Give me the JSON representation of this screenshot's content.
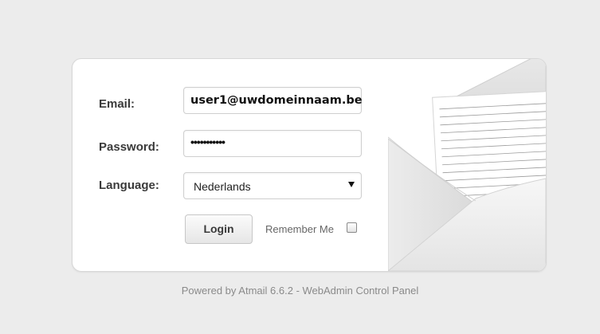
{
  "login": {
    "email_label": "Email:",
    "email_value": "user1@uwdomeinnaam.be",
    "password_label": "Password:",
    "password_value": "•••••••••••",
    "language_label": "Language:",
    "language_selected": "Nederlands",
    "login_button": "Login",
    "remember_label": "Remember Me"
  },
  "footer": {
    "text": "Powered by Atmail 6.6.2 - WebAdmin Control Panel"
  },
  "icons": {
    "envelope": "envelope-letter-icon",
    "select_arrow": "caret-down-icon"
  }
}
